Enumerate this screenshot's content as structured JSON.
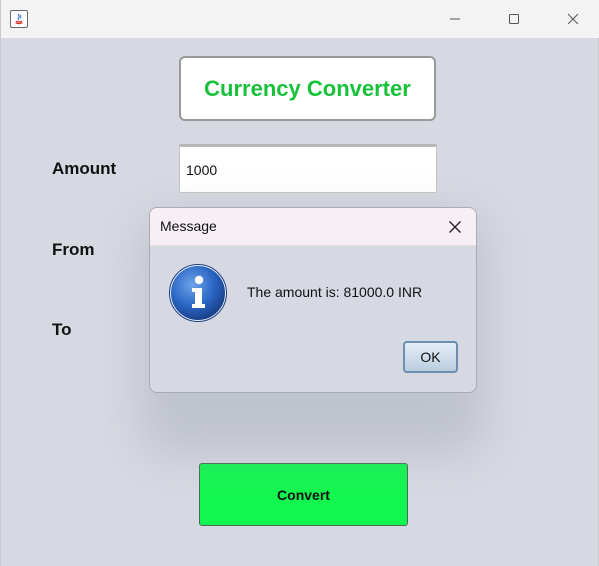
{
  "window": {
    "icon": "java-icon",
    "controls": {
      "minimize": "minimize-icon",
      "maximize": "maximize-icon",
      "close": "close-icon"
    }
  },
  "app": {
    "title": "Currency Converter",
    "amount_label": "Amount",
    "from_label": "From",
    "to_label": "To",
    "amount_value": "1000",
    "convert_label": "Convert"
  },
  "dialog": {
    "title": "Message",
    "message": "The amount is: 81000.0 INR",
    "ok_label": "OK",
    "icon": "info-icon"
  },
  "colors": {
    "title_text": "#17c13a",
    "convert_button": "#12f74f",
    "window_background": "#d6d9e1",
    "dialog_titlebar": "#f8eef5",
    "info_icon": "#2a66c4"
  }
}
